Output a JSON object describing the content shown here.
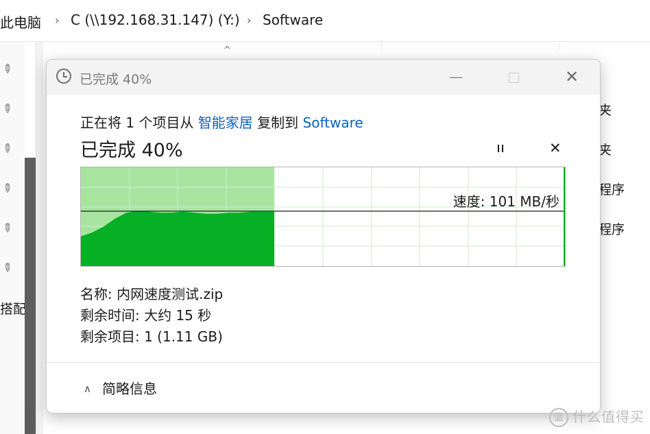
{
  "explorer": {
    "breadcrumb": [
      "此电脑",
      "C (\\\\192.168.31.147) (Y:)",
      "Software"
    ],
    "left_label": "搭配",
    "right_labels": [
      "夹",
      "夹",
      "程序",
      "程序"
    ]
  },
  "dialog": {
    "title": "已完成 40%",
    "copy_prefix": "正在将 1 个项目从",
    "source": "智能家居",
    "copy_mid": "复制到",
    "destination": "Software",
    "progress_heading": "已完成 40%",
    "progress_percent": 40,
    "speed_text": "速度: 101 MB/秒",
    "name_row": "名称: 内网速度测试.zip",
    "time_row": "剩余时间: 大约 15 秒",
    "items_row": "剩余项目: 1 (1.11 GB)",
    "toggle_label": "简略信息"
  },
  "watermark": "什么值得买",
  "colors": {
    "accent": "#0a62bf",
    "graph_fill": "#06b025",
    "graph_progress_bg": "#a8e4a0",
    "graph_grid": "#cfeecb"
  }
}
